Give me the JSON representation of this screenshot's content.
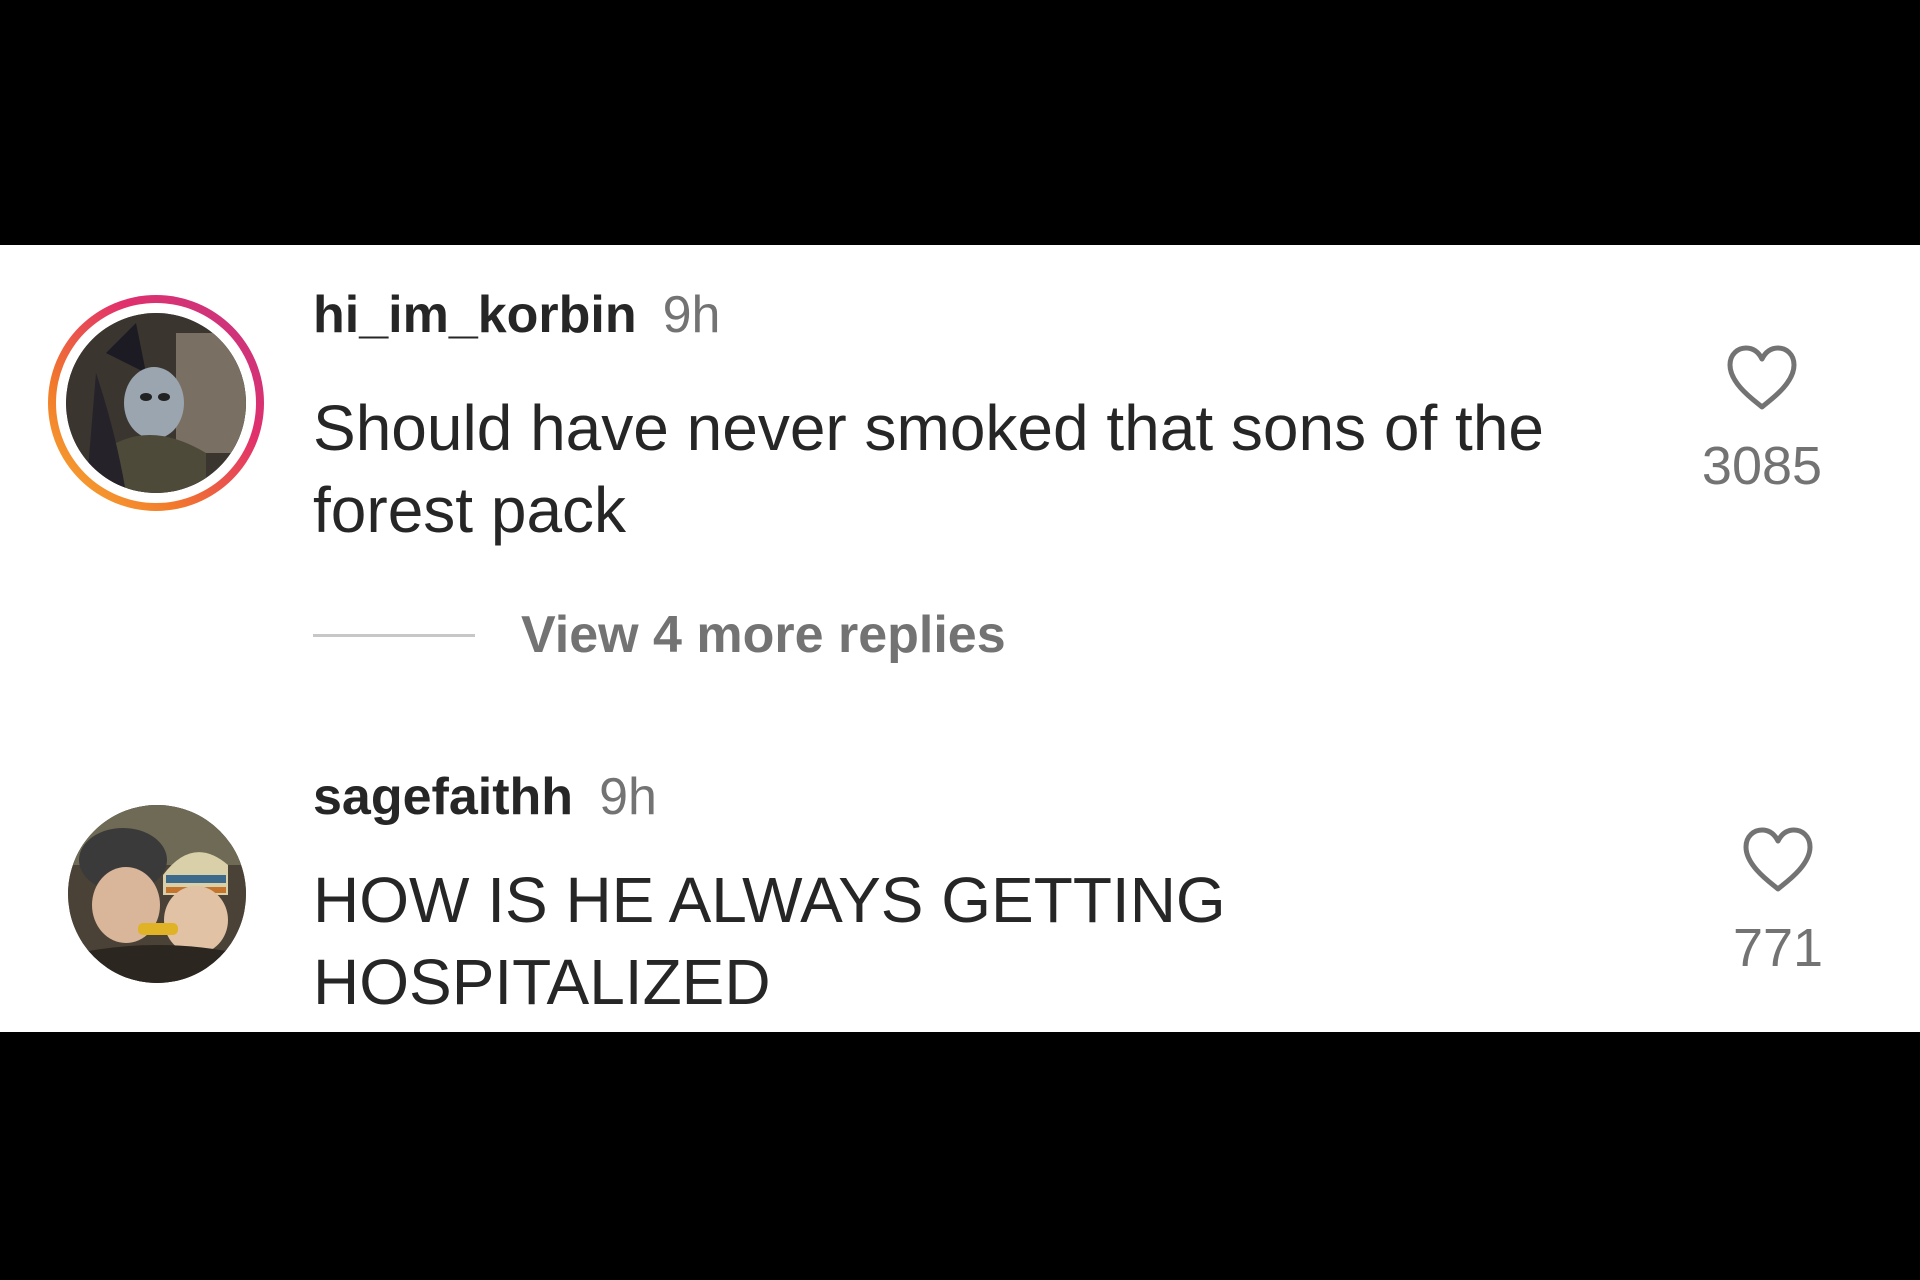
{
  "comments": [
    {
      "username": "hi_im_korbin",
      "time": "9h",
      "text": "Should have never smoked that sons of the forest pack",
      "likes": "3085",
      "avatar_has_story_ring": true,
      "replies_label": "View 4 more replies"
    },
    {
      "username": "sagefaithh",
      "time": "9h",
      "text": "HOW IS HE ALWAYS GETTING HOSPITALIZED",
      "likes": "771",
      "avatar_has_story_ring": false
    }
  ],
  "icons": {
    "like": "heart-outline-icon"
  },
  "colors": {
    "primary_text": "#262626",
    "secondary_text": "#737373",
    "story_ring_start": "#f7b233",
    "story_ring_end": "#c13584"
  }
}
